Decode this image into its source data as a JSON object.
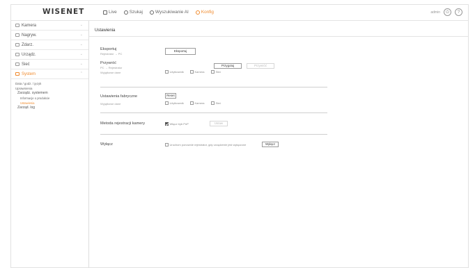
{
  "header": {
    "logo": "WISENET",
    "nav": [
      {
        "label": "Live",
        "icon": "monitor-icon"
      },
      {
        "label": "Szukaj",
        "icon": "search-icon"
      },
      {
        "label": "Wyszukiwanie AI",
        "icon": "ai-search-icon"
      },
      {
        "label": "Konfig",
        "icon": "gear-icon"
      }
    ],
    "user": "admin",
    "logout_icon": "power-icon",
    "help_icon": "help-icon",
    "help_symbol": "?",
    "active_color": "#f08a2c"
  },
  "sidebar": {
    "items": [
      {
        "label": "Kamera",
        "icon": "camera-icon"
      },
      {
        "label": "Nagryw.",
        "icon": "record-icon"
      },
      {
        "label": "Zdarz.",
        "icon": "event-icon"
      },
      {
        "label": "Urządz.",
        "icon": "device-icon"
      },
      {
        "label": "Sieć",
        "icon": "network-icon"
      },
      {
        "label": "System",
        "icon": "system-icon"
      }
    ],
    "chevron": "⌄",
    "system_sub": [
      "Data / godz. / język",
      "Uprawnienia",
      "Zarządz. systemem",
      "Informacje o produkcie",
      "Ustawienia",
      "Zarząd. log"
    ]
  },
  "main": {
    "title": "Ustawienia",
    "export": {
      "label": "Eksportuj",
      "path": "Rejestrator → PC",
      "button": "Eksportuj"
    },
    "import": {
      "label": "Przywróć",
      "path": "PC → Rejestrator",
      "prepare": "Przygotuj",
      "run": "Przywróć",
      "exclude_label": "Wyjątkowe dane",
      "options": [
        "Użytkownik",
        "Kamera",
        "Sieć"
      ]
    },
    "factory": {
      "label": "Ustawienia fabryczne",
      "button": "Reset",
      "exclude_label": "Wyjątkowe dane",
      "options": [
        "Użytkownik",
        "Kamera",
        "Sieć"
      ]
    },
    "camera_reg": {
      "label": "Metoda rejestracji kamery",
      "option": "Włącz tryb PnP",
      "button": "Ustaw"
    },
    "reboot": {
      "label": "Wyłącz",
      "option": "Uruchom ponownie rejestrator, gdy urządzenie jest wyłączone",
      "button": "Wyłącz"
    }
  }
}
